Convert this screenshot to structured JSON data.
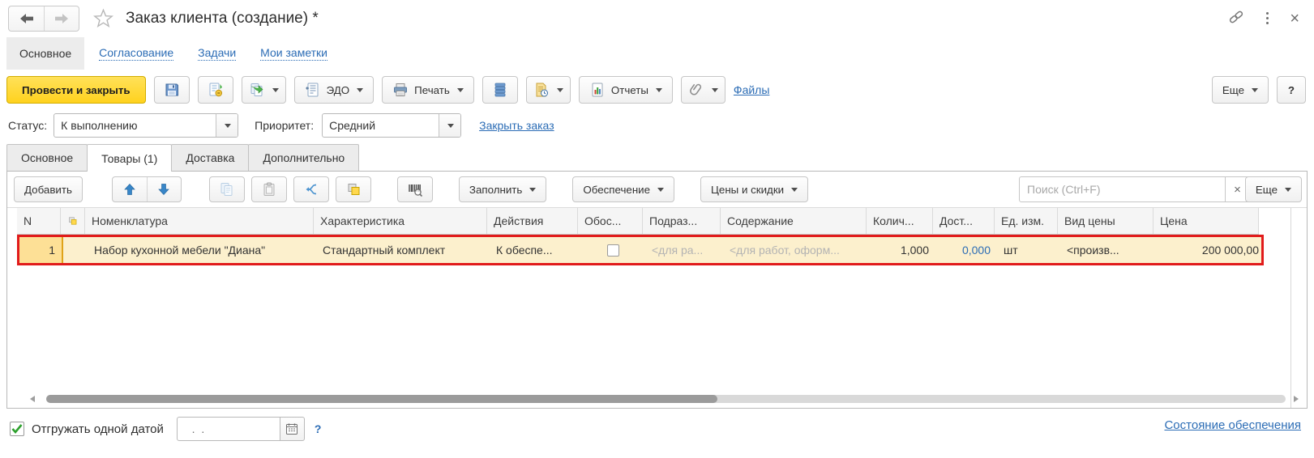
{
  "header": {
    "title": "Заказ клиента (создание) *",
    "close_glyph": "×"
  },
  "nav_tabs": {
    "active": "Основное",
    "links": [
      "Согласование",
      "Задачи",
      "Мои заметки"
    ]
  },
  "toolbar": {
    "post_and_close": "Провести и закрыть",
    "edo": "ЭДО",
    "print": "Печать",
    "reports": "Отчеты",
    "files": "Файлы",
    "more": "Еще",
    "help": "?"
  },
  "status_bar": {
    "status_label": "Статус:",
    "status_value": "К выполнению",
    "priority_label": "Приоритет:",
    "priority_value": "Средний",
    "close_order_link": "Закрыть заказ"
  },
  "doc_tabs": {
    "items": [
      "Основное",
      "Товары (1)",
      "Доставка",
      "Дополнительно"
    ],
    "active": "Товары (1)"
  },
  "grid_toolbar": {
    "add": "Добавить",
    "fill": "Заполнить",
    "supply": "Обеспечение",
    "prices_discounts": "Цены и скидки",
    "search_placeholder": "Поиск (Ctrl+F)",
    "clear_glyph": "×",
    "more": "Еще"
  },
  "grid": {
    "columns": [
      "N",
      "Номенклатура",
      "Характеристика",
      "Действия",
      "Обос...",
      "Подраз...",
      "Содержание",
      "Колич...",
      "Дост...",
      "Ед. изм.",
      "Вид цены",
      "Цена"
    ],
    "row": {
      "n": "1",
      "nomenclature": "Набор кухонной мебели \"Диана\"",
      "characteristic": "Стандартный комплект",
      "actions": "К обеспе...",
      "department": "<для ра...",
      "content": "<для работ, оформ...",
      "quantity": "1,000",
      "shipped": "0,000",
      "unit": "шт",
      "price_kind": "<произв...",
      "price": "200 000,00"
    }
  },
  "footer": {
    "ship_one_date_label": "Отгружать одной датой",
    "date_value": "  .  .",
    "help": "?",
    "supply_status_link": "Состояние обеспечения"
  },
  "colors": {
    "accent_yellow": "#ffd21e",
    "selection_border": "#e11b1b",
    "row_highlight": "#fcf0cd",
    "current_cell": "#fde096",
    "link_blue": "#2b6cb5"
  }
}
